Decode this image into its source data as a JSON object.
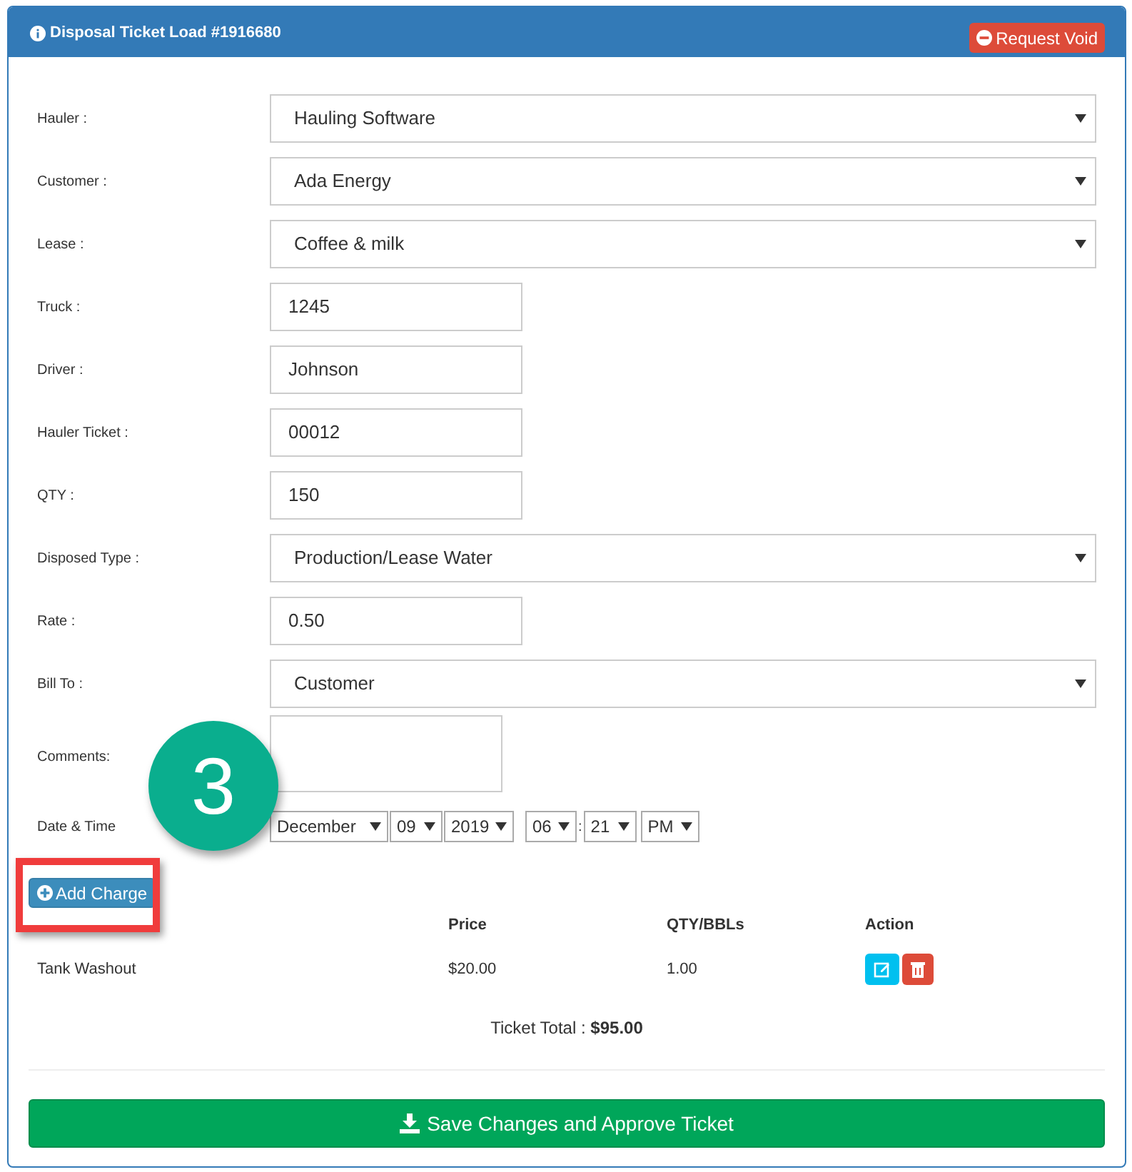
{
  "panel": {
    "title": "Disposal Ticket Load #1916680",
    "void_button": "Request Void"
  },
  "fields": [
    {
      "kind": "select",
      "label": "Hauler :",
      "value": "Hauling Software"
    },
    {
      "kind": "select",
      "label": "Customer :",
      "value": "Ada Energy"
    },
    {
      "kind": "select",
      "label": "Lease :",
      "value": "Coffee & milk"
    },
    {
      "kind": "text",
      "label": "Truck :",
      "value": "1245"
    },
    {
      "kind": "text",
      "label": "Driver :",
      "value": "Johnson"
    },
    {
      "kind": "text",
      "label": "Hauler Ticket :",
      "value": "00012"
    },
    {
      "kind": "text",
      "label": "QTY :",
      "value": "150"
    },
    {
      "kind": "select",
      "label": "Disposed Type :",
      "value": "Production/Lease Water"
    },
    {
      "kind": "text",
      "label": "Rate :",
      "value": "0.50"
    },
    {
      "kind": "select",
      "label": "Bill To :",
      "value": "Customer"
    },
    {
      "kind": "textarea",
      "label": "Comments:"
    }
  ],
  "date_time": {
    "label": "Date & Time",
    "month": "December",
    "day": "09",
    "year": "2019",
    "hour": "06",
    "separator": ":",
    "minute": "21",
    "ampm": "PM"
  },
  "add_charge_button": "Add Charge",
  "callout": {
    "number": "3"
  },
  "charges": {
    "columns": [
      "",
      "Price",
      "QTY/BBLs",
      "Action"
    ],
    "rows": [
      {
        "name": "Tank Washout",
        "price": "$20.00",
        "qty": "1.00"
      }
    ]
  },
  "total": {
    "label": "Ticket Total :",
    "value": "$95.00"
  },
  "save_button": "Save Changes and Approve Ticket"
}
